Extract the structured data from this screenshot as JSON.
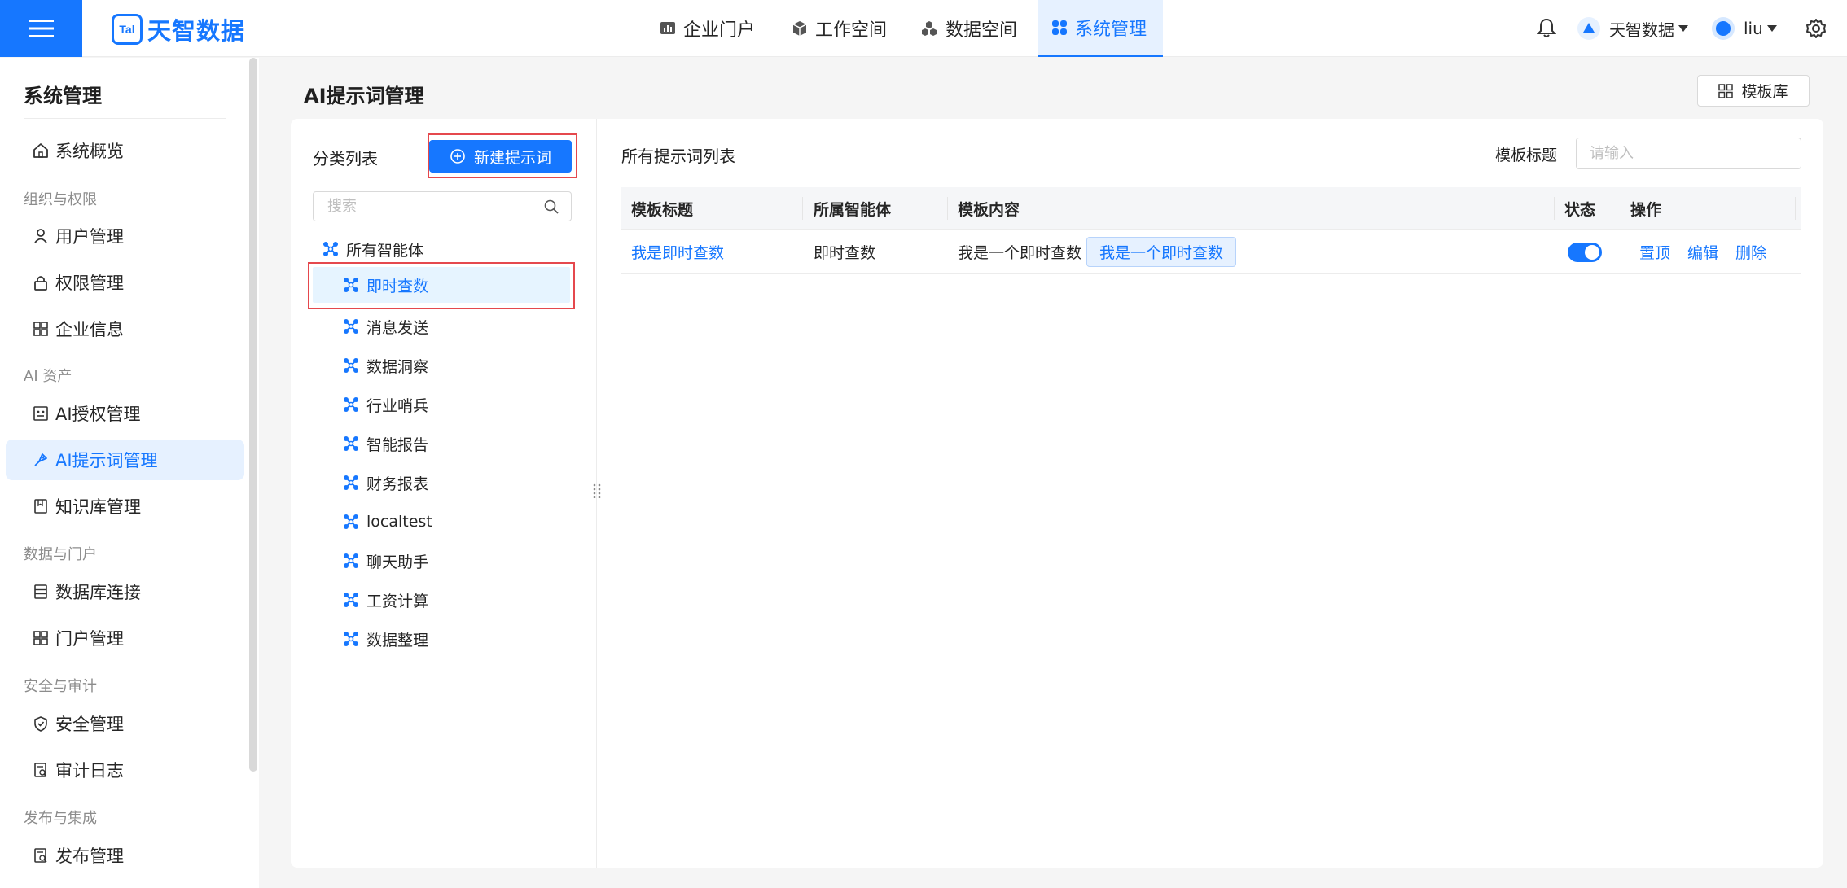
{
  "brand": {
    "logo_mark": "Tal",
    "name": "天智数据"
  },
  "nav": [
    {
      "label": "企业门户",
      "icon": "bar-chart-icon"
    },
    {
      "label": "工作空间",
      "icon": "cube-icon"
    },
    {
      "label": "数据空间",
      "icon": "cubes-icon"
    },
    {
      "label": "系统管理",
      "icon": "apps-icon",
      "active": true
    }
  ],
  "top_right": {
    "org": "天智数据",
    "user": "liu"
  },
  "sidebar": {
    "title": "系统管理",
    "items": [
      {
        "type": "item",
        "label": "系统概览",
        "icon": "home-icon"
      },
      {
        "type": "group",
        "label": "组织与权限"
      },
      {
        "type": "item",
        "label": "用户管理",
        "icon": "user-icon"
      },
      {
        "type": "item",
        "label": "权限管理",
        "icon": "lock-icon"
      },
      {
        "type": "item",
        "label": "企业信息",
        "icon": "grid-icon"
      },
      {
        "type": "group",
        "label": "AI 资产"
      },
      {
        "type": "item",
        "label": "AI授权管理",
        "icon": "ai-auth-icon"
      },
      {
        "type": "item",
        "label": "AI提示词管理",
        "icon": "prompt-icon",
        "active": true
      },
      {
        "type": "item",
        "label": "知识库管理",
        "icon": "book-icon"
      },
      {
        "type": "group",
        "label": "数据与门户"
      },
      {
        "type": "item",
        "label": "数据库连接",
        "icon": "database-icon"
      },
      {
        "type": "item",
        "label": "门户管理",
        "icon": "grid-icon"
      },
      {
        "type": "group",
        "label": "安全与审计"
      },
      {
        "type": "item",
        "label": "安全管理",
        "icon": "shield-icon"
      },
      {
        "type": "item",
        "label": "审计日志",
        "icon": "audit-log-icon"
      },
      {
        "type": "group",
        "label": "发布与集成"
      },
      {
        "type": "item",
        "label": "发布管理",
        "icon": "publish-icon"
      }
    ]
  },
  "page": {
    "title": "AI提示词管理",
    "template_lib": "模板库"
  },
  "category": {
    "title": "分类列表",
    "new_button": "新建提示词",
    "search_placeholder": "搜索",
    "root": "所有智能体",
    "items": [
      "即时查数",
      "消息发送",
      "数据洞察",
      "行业哨兵",
      "智能报告",
      "财务报表",
      "localtest",
      "聊天助手",
      "工资计算",
      "数据整理"
    ],
    "selected": "即时查数"
  },
  "list": {
    "title": "所有提示词列表",
    "filter_label": "模板标题",
    "filter_placeholder": "请输入",
    "columns": [
      "模板标题",
      "所属智能体",
      "模板内容",
      "状态",
      "操作"
    ],
    "rows": [
      {
        "title": "我是即时查数",
        "agent": "即时查数",
        "content": "我是一个即时查数",
        "content_tag": "我是一个即时查数",
        "enabled": true,
        "actions": [
          "置顶",
          "编辑",
          "删除"
        ]
      }
    ]
  }
}
